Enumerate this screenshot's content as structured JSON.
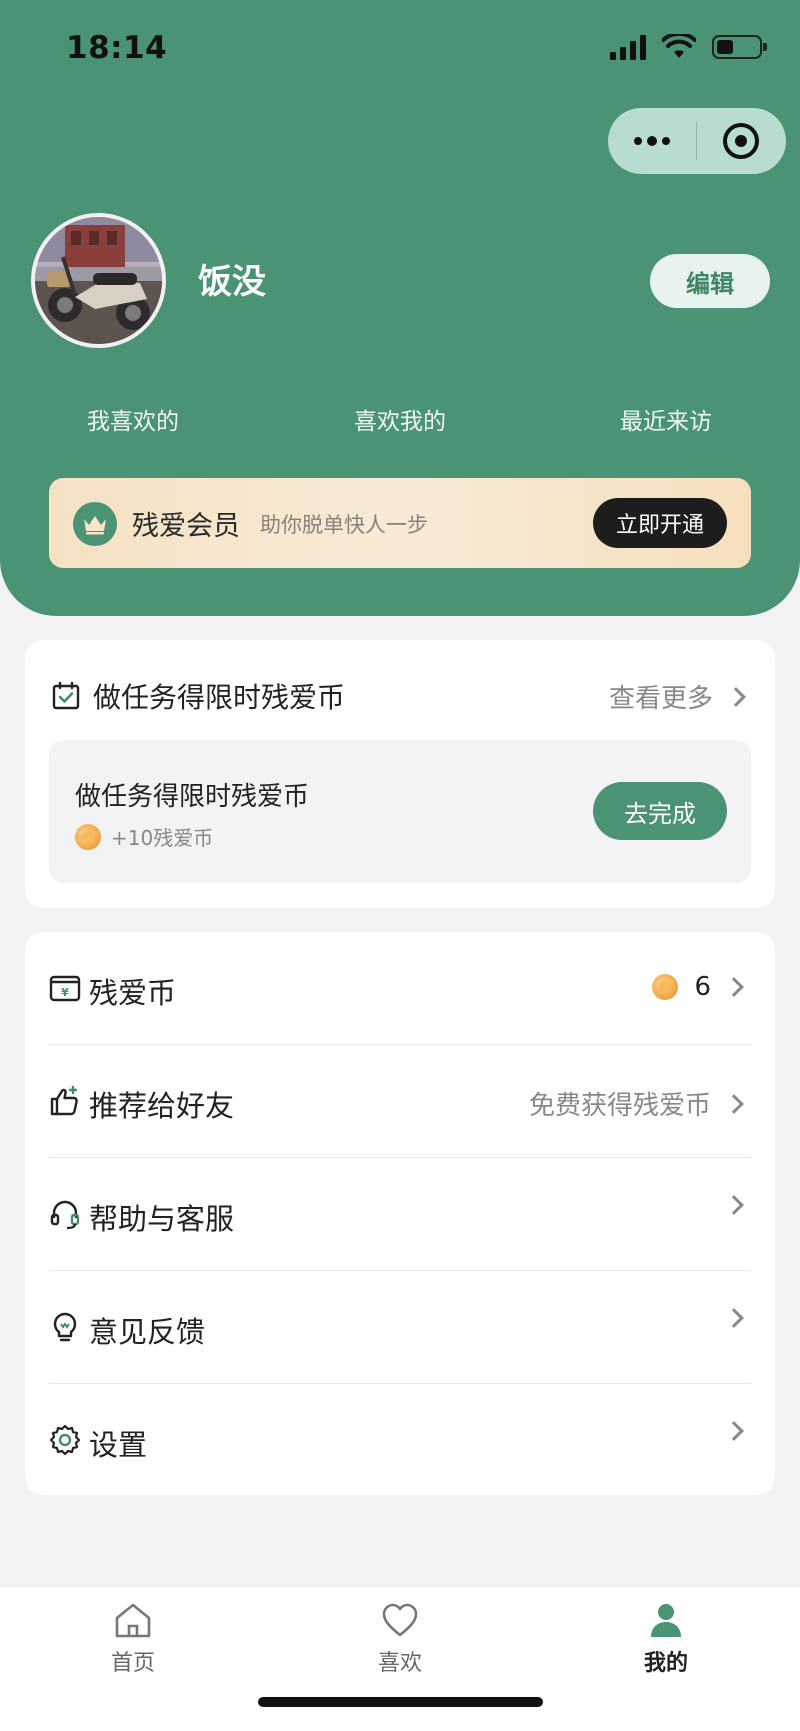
{
  "status_bar": {
    "time": "18:14"
  },
  "profile": {
    "username": "饭没",
    "edit_label": "编辑",
    "stats": {
      "i_like": "我喜欢的",
      "likes_me": "喜欢我的",
      "recent_visits": "最近来访"
    }
  },
  "vip": {
    "title": "残爱会员",
    "subtitle": "助你脱单快人一步",
    "button": "立即开通"
  },
  "tasks": {
    "header": "做任务得限时残爱币",
    "see_more": "查看更多",
    "item": {
      "name": "做任务得限时残爱币",
      "reward": "+10残爱币",
      "button": "去完成"
    }
  },
  "menu": {
    "coins": {
      "label": "残爱币",
      "value": "6"
    },
    "recommend": {
      "label": "推荐给好友",
      "hint": "免费获得残爱币"
    },
    "help": {
      "label": "帮助与客服"
    },
    "feedback": {
      "label": "意见反馈"
    },
    "settings": {
      "label": "设置"
    }
  },
  "tabbar": {
    "home": "首页",
    "likes": "喜欢",
    "mine": "我的"
  },
  "colors": {
    "brand_green": "#4a9374",
    "capsule": "#b8dccd",
    "vip_bg": "#f6e1c3"
  }
}
